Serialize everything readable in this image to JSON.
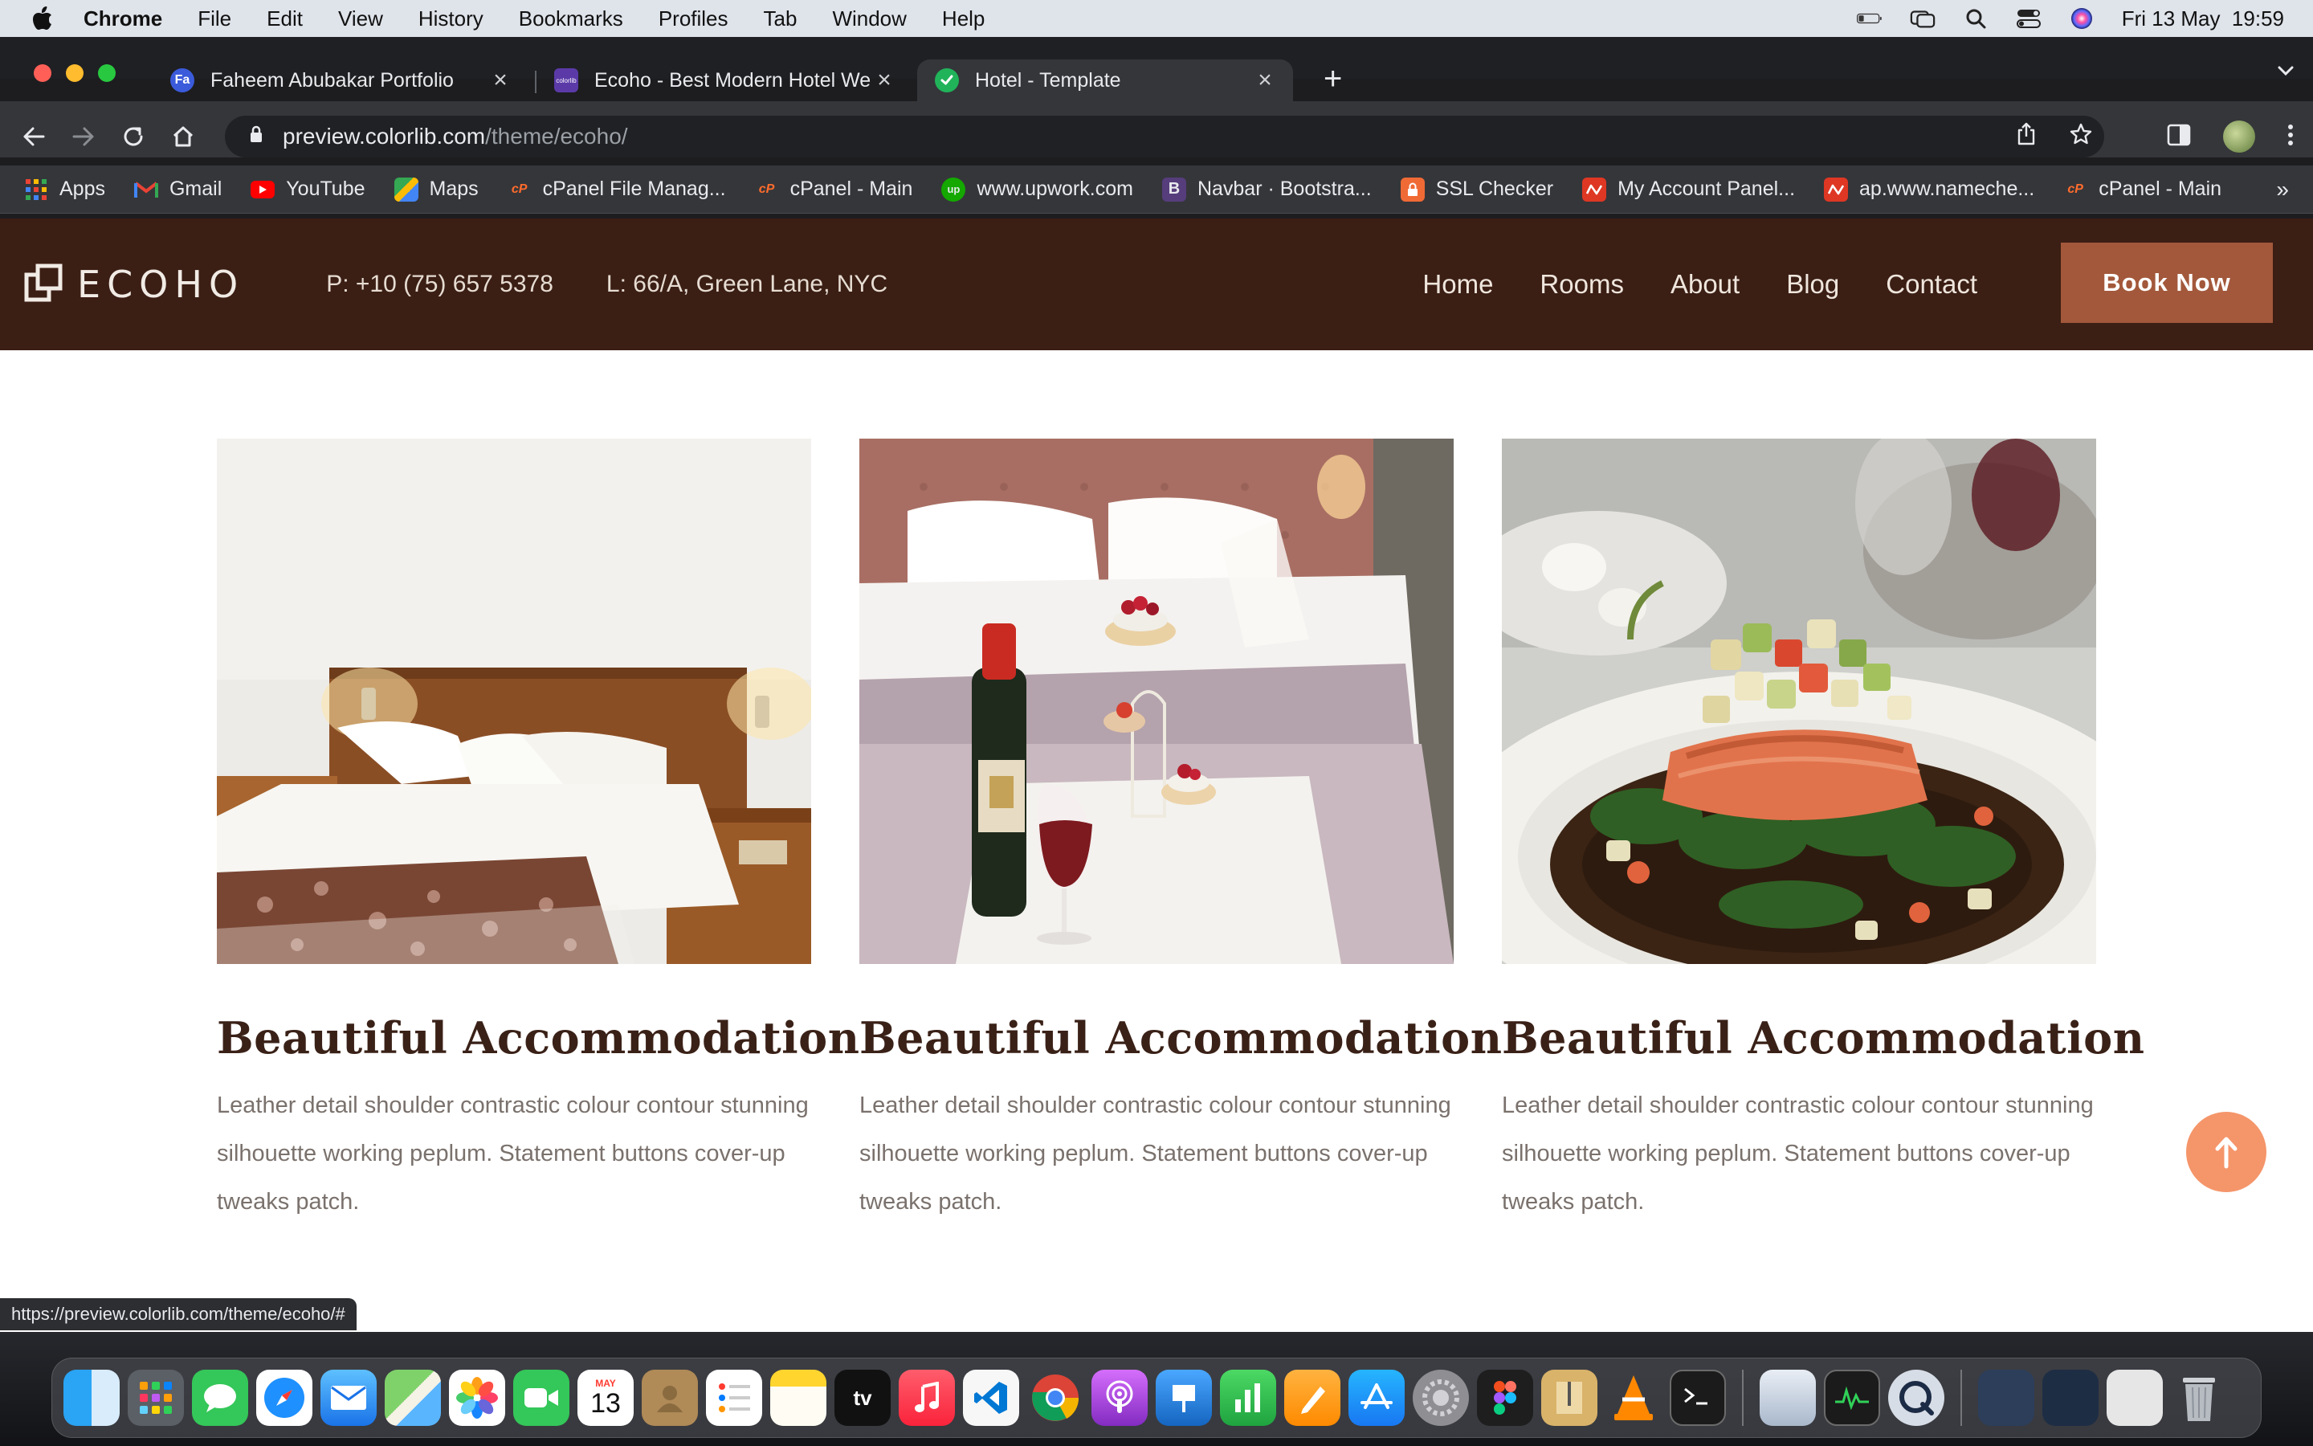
{
  "menubar": {
    "app": "Chrome",
    "items": [
      "File",
      "Edit",
      "View",
      "History",
      "Bookmarks",
      "Profiles",
      "Tab",
      "Window",
      "Help"
    ],
    "clock": "Fri 13 May  19:59"
  },
  "tabs": [
    {
      "title": "Faheem Abubakar Portfolio",
      "favicon": "Fa"
    },
    {
      "title": "Ecoho - Best Modern Hotel We",
      "favicon": "colorlib"
    },
    {
      "title": "Hotel - Template",
      "favicon": "check"
    }
  ],
  "address": {
    "host": "preview.colorlib.com",
    "path": "/theme/ecoho/"
  },
  "bookmarks": [
    {
      "label": "Apps",
      "icon": "apps-grid-icon"
    },
    {
      "label": "Gmail",
      "icon": "gmail-icon"
    },
    {
      "label": "YouTube",
      "icon": "youtube-icon"
    },
    {
      "label": "Maps",
      "icon": "maps-icon"
    },
    {
      "label": "cPanel File Manag...",
      "icon": "cpanel-icon"
    },
    {
      "label": "cPanel - Main",
      "icon": "cpanel-icon"
    },
    {
      "label": "www.upwork.com",
      "icon": "upwork-icon"
    },
    {
      "label": "Navbar · Bootstra...",
      "icon": "bootstrap-icon"
    },
    {
      "label": "SSL Checker",
      "icon": "ssl-lock-icon"
    },
    {
      "label": "My Account Panel...",
      "icon": "namecheap-icon"
    },
    {
      "label": "ap.www.nameche...",
      "icon": "namecheap-icon"
    },
    {
      "label": "cPanel - Main",
      "icon": "cpanel-icon"
    }
  ],
  "site": {
    "logo": "ECOHO",
    "phone": "P: +10 (75) 657 5378",
    "location": "L: 66/A, Green Lane, NYC",
    "nav": [
      "Home",
      "Rooms",
      "About",
      "Blog",
      "Contact"
    ],
    "cta": "Book Now",
    "cards": [
      {
        "title": "Beautiful Accommodation",
        "text": "Leather detail shoulder contrastic colour contour stunning silhouette working peplum. Statement buttons cover-up tweaks patch.",
        "image": "hotel-bedroom-photo"
      },
      {
        "title": "Beautiful Accommodation",
        "text": "Leather detail shoulder contrastic colour contour stunning silhouette working peplum. Statement buttons cover-up tweaks patch.",
        "image": "champagne-dessert-bed-photo"
      },
      {
        "title": "Beautiful Accommodation",
        "text": "Leather detail shoulder contrastic colour contour stunning silhouette working peplum. Statement buttons cover-up tweaks patch.",
        "image": "salmon-dinner-photo"
      }
    ]
  },
  "status_url": "https://preview.colorlib.com/theme/ecoho/#",
  "dock": {
    "calendar_month": "MAY",
    "calendar_day": "13",
    "tv_label": "tv"
  },
  "colors": {
    "header_bg": "#3b1e14",
    "cta_bg": "#a3583b",
    "title_color": "#3a2117",
    "scroll_top_bg": "#f5956a"
  }
}
